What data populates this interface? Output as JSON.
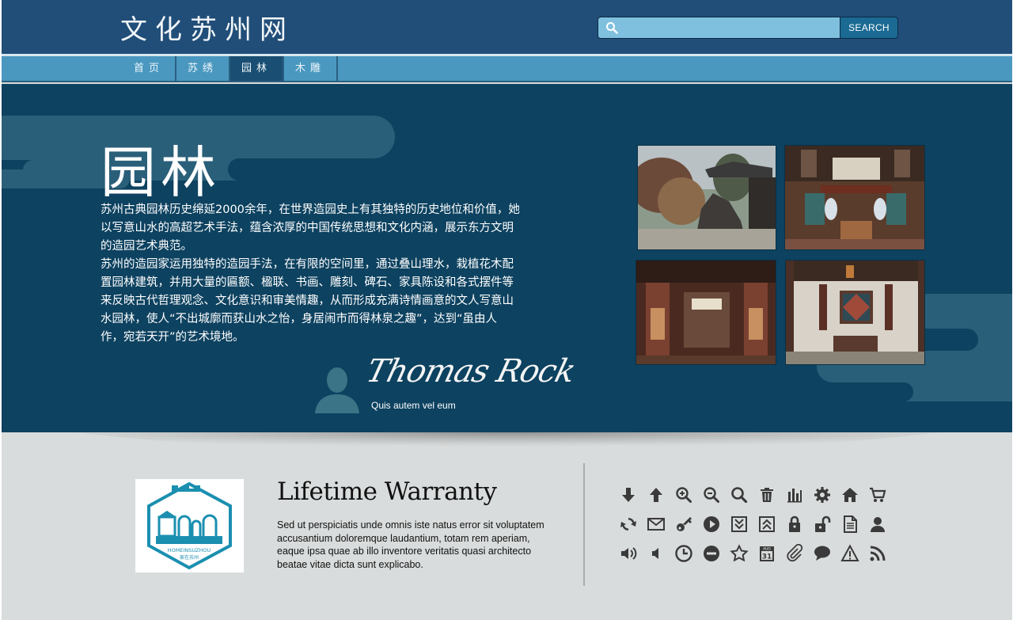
{
  "header": {
    "site_title": "文化苏州网",
    "search": {
      "placeholder": "",
      "button_label": "SEARCH"
    }
  },
  "nav": {
    "tabs": [
      {
        "label": "首页",
        "active": false
      },
      {
        "label": "苏绣",
        "active": false
      },
      {
        "label": "园林",
        "active": true
      },
      {
        "label": "木雕",
        "active": false
      }
    ]
  },
  "hero": {
    "title": "园林",
    "paragraphs": [
      "苏州古典园林历史绵延2000余年，在世界造园史上有其独特的历史地位和价值，她以写意山水的高超艺术手法，蕴含浓厚的中国传统思想和文化内涵，展示东方文明的造园艺术典范。",
      "苏州的造园家运用独特的造园手法，在有限的空间里，通过叠山理水，栽植花木配置园林建筑，并用大量的匾额、楹联、书画、雕刻、碑石、家具陈设和各式摆件等来反映古代哲理观念、文化意识和审美情趣，从而形成充满诗情画意的文人写意山水园林，使人“不出城廓而获山水之怡，身居闹市而得林泉之趣”，达到“虽由人作，宛若天开”的艺术境地。"
    ],
    "signature": "Thomas Rock",
    "author_caption": "Quis autem vel eum"
  },
  "feature": {
    "logo_text_en": "HOMEINSUZHOU",
    "logo_text_cn": "家在苏州",
    "title": "Lifetime Warranty",
    "body": "Sed ut perspiciatis unde omnis iste natus error sit voluptatem accusantium doloremque laudantium, totam rem aperiam, eaque ipsa quae ab illo inventore veritatis quasi architecto beatae vitae dicta sunt explicabo."
  },
  "icons": [
    "arrow-down-icon",
    "arrow-up-icon",
    "zoom-in-icon",
    "zoom-out-icon",
    "search-icon",
    "trash-icon",
    "bar-chart-icon",
    "gear-icon",
    "home-icon",
    "cart-icon",
    "refresh-icon",
    "mail-icon",
    "key-icon",
    "play-icon",
    "chevron-down-box-icon",
    "chevron-up-box-icon",
    "lock-icon",
    "unlock-icon",
    "document-icon",
    "user-icon",
    "volume-up-icon",
    "volume-low-icon",
    "clock-icon",
    "minus-circle-icon",
    "star-icon",
    "calendar-icon",
    "paperclip-icon",
    "speech-bubble-icon",
    "warning-icon",
    "rss-icon"
  ],
  "calendar_icon": {
    "month": "AUG",
    "day": "31"
  },
  "colors": {
    "header_bg": "#214e78",
    "nav_bg": "#4a98c0",
    "hero_bg": "#0d4260",
    "accent": "#1a6a93",
    "logo_teal": "#1b8fb0"
  }
}
